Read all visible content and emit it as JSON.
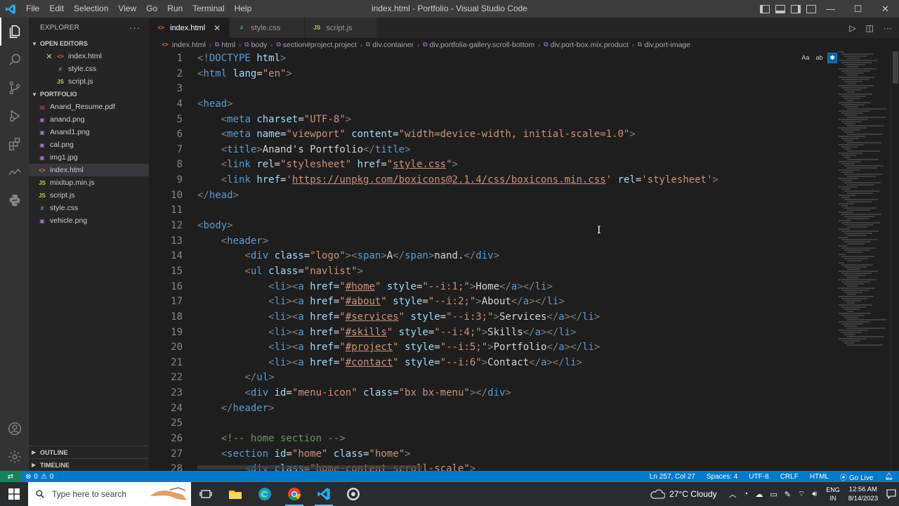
{
  "titlebar": {
    "menu": [
      "File",
      "Edit",
      "Selection",
      "View",
      "Go",
      "Run",
      "Terminal",
      "Help"
    ],
    "window_title": "index.html - Portfolio - Visual Studio Code"
  },
  "sidebar": {
    "header": "EXPLORER",
    "more": "···",
    "open_editors_title": "OPEN EDITORS",
    "open_editors": [
      {
        "name": "index.html",
        "type": "html",
        "badge": "<>"
      },
      {
        "name": "style.css",
        "type": "css",
        "badge": "#"
      },
      {
        "name": "script.js",
        "type": "js",
        "badge": "JS"
      }
    ],
    "folder_title": "PORTFOLIO",
    "files": [
      {
        "name": "Anand_Resume.pdf",
        "type": "pdf",
        "badge": "▤"
      },
      {
        "name": "anand.png",
        "type": "img",
        "badge": "▣"
      },
      {
        "name": "Anand1.png",
        "type": "img",
        "badge": "▣"
      },
      {
        "name": "cal.png",
        "type": "img",
        "badge": "▣"
      },
      {
        "name": "img1.jpg",
        "type": "img",
        "badge": "▣"
      },
      {
        "name": "index.html",
        "type": "html",
        "badge": "<>"
      },
      {
        "name": "mixitup.min.js",
        "type": "js",
        "badge": "JS"
      },
      {
        "name": "script.js",
        "type": "js",
        "badge": "JS"
      },
      {
        "name": "style.css",
        "type": "css",
        "badge": "#"
      },
      {
        "name": "vehicle.png",
        "type": "img",
        "badge": "▣"
      }
    ],
    "outline_title": "OUTLINE",
    "timeline_title": "TIMELINE"
  },
  "tabs": [
    {
      "label": "index.html",
      "type": "html",
      "badge": "<>",
      "active": true
    },
    {
      "label": "style.css",
      "type": "css",
      "badge": "#",
      "active": false
    },
    {
      "label": "script.js",
      "type": "js",
      "badge": "JS",
      "active": false
    }
  ],
  "breadcrumbs": [
    "index.html",
    "html",
    "body",
    "section#project.project",
    "div.container",
    "div.portfolia-gallery.scroll-bottom",
    "div.port-box.mix.product",
    "div.port-image"
  ],
  "find_toggles": [
    "Aa",
    "ab",
    "✱"
  ],
  "code": {
    "line_numbers": [
      "1",
      "2",
      "3",
      "4",
      "5",
      "6",
      "7",
      "8",
      "9",
      "10",
      "11",
      "12",
      "13",
      "14",
      "15",
      "16",
      "17",
      "18",
      "19",
      "20",
      "21",
      "22",
      "23",
      "24",
      "25",
      "26",
      "27",
      "28"
    ],
    "lines": [
      [
        [
          "br",
          "<!"
        ],
        [
          "tag",
          "DOCTYPE"
        ],
        [
          "tx",
          " "
        ],
        [
          "at",
          "html"
        ],
        [
          "br",
          ">"
        ]
      ],
      [
        [
          "br",
          "<"
        ],
        [
          "tag",
          "html"
        ],
        [
          "tx",
          " "
        ],
        [
          "at",
          "lang"
        ],
        [
          "tx",
          "="
        ],
        [
          "st",
          "\"en\""
        ],
        [
          "br",
          ">"
        ]
      ],
      [],
      [
        [
          "br",
          "<"
        ],
        [
          "tag",
          "head"
        ],
        [
          "br",
          ">"
        ]
      ],
      [
        [
          "tx",
          "    "
        ],
        [
          "br",
          "<"
        ],
        [
          "tag",
          "meta"
        ],
        [
          "tx",
          " "
        ],
        [
          "at",
          "charset"
        ],
        [
          "tx",
          "="
        ],
        [
          "st",
          "\"UTF-8\""
        ],
        [
          "br",
          ">"
        ]
      ],
      [
        [
          "tx",
          "    "
        ],
        [
          "br",
          "<"
        ],
        [
          "tag",
          "meta"
        ],
        [
          "tx",
          " "
        ],
        [
          "at",
          "name"
        ],
        [
          "tx",
          "="
        ],
        [
          "st",
          "\"viewport\""
        ],
        [
          "tx",
          " "
        ],
        [
          "at",
          "content"
        ],
        [
          "tx",
          "="
        ],
        [
          "st",
          "\"width=device-width, initial-scale=1.0\""
        ],
        [
          "br",
          ">"
        ]
      ],
      [
        [
          "tx",
          "    "
        ],
        [
          "br",
          "<"
        ],
        [
          "tag",
          "title"
        ],
        [
          "br",
          ">"
        ],
        [
          "tx",
          "Anand's Portfolio"
        ],
        [
          "br",
          "</"
        ],
        [
          "tag",
          "title"
        ],
        [
          "br",
          ">"
        ]
      ],
      [
        [
          "tx",
          "    "
        ],
        [
          "br",
          "<"
        ],
        [
          "tag",
          "link"
        ],
        [
          "tx",
          " "
        ],
        [
          "at",
          "rel"
        ],
        [
          "tx",
          "="
        ],
        [
          "st",
          "\"stylesheet\""
        ],
        [
          "tx",
          " "
        ],
        [
          "at",
          "href"
        ],
        [
          "tx",
          "="
        ],
        [
          "st",
          "\""
        ],
        [
          "ln",
          "style.css"
        ],
        [
          "st",
          "\""
        ],
        [
          "br",
          ">"
        ]
      ],
      [
        [
          "tx",
          "    "
        ],
        [
          "br",
          "<"
        ],
        [
          "tag",
          "link"
        ],
        [
          "tx",
          " "
        ],
        [
          "at",
          "href"
        ],
        [
          "tx",
          "="
        ],
        [
          "st",
          "'"
        ],
        [
          "ln",
          "https://unpkg.com/boxicons@2.1.4/css/boxicons.min.css"
        ],
        [
          "st",
          "'"
        ],
        [
          "tx",
          " "
        ],
        [
          "at",
          "rel"
        ],
        [
          "tx",
          "="
        ],
        [
          "st",
          "'stylesheet'"
        ],
        [
          "br",
          ">"
        ]
      ],
      [
        [
          "br",
          "</"
        ],
        [
          "tag",
          "head"
        ],
        [
          "br",
          ">"
        ]
      ],
      [],
      [
        [
          "br",
          "<"
        ],
        [
          "tag",
          "body"
        ],
        [
          "br",
          ">"
        ]
      ],
      [
        [
          "tx",
          "    "
        ],
        [
          "br",
          "<"
        ],
        [
          "tag",
          "header"
        ],
        [
          "br",
          ">"
        ]
      ],
      [
        [
          "tx",
          "        "
        ],
        [
          "br",
          "<"
        ],
        [
          "tag",
          "div"
        ],
        [
          "tx",
          " "
        ],
        [
          "at",
          "class"
        ],
        [
          "tx",
          "="
        ],
        [
          "st",
          "\"logo\""
        ],
        [
          "br",
          "><"
        ],
        [
          "tag",
          "span"
        ],
        [
          "br",
          ">"
        ],
        [
          "tx",
          "A"
        ],
        [
          "br",
          "</"
        ],
        [
          "tag",
          "span"
        ],
        [
          "br",
          ">"
        ],
        [
          "tx",
          "nand."
        ],
        [
          "br",
          "</"
        ],
        [
          "tag",
          "div"
        ],
        [
          "br",
          ">"
        ]
      ],
      [
        [
          "tx",
          "        "
        ],
        [
          "br",
          "<"
        ],
        [
          "tag",
          "ul"
        ],
        [
          "tx",
          " "
        ],
        [
          "at",
          "class"
        ],
        [
          "tx",
          "="
        ],
        [
          "st",
          "\"navlist\""
        ],
        [
          "br",
          ">"
        ]
      ],
      [
        [
          "tx",
          "            "
        ],
        [
          "br",
          "<"
        ],
        [
          "tag",
          "li"
        ],
        [
          "br",
          "><"
        ],
        [
          "tag",
          "a"
        ],
        [
          "tx",
          " "
        ],
        [
          "at",
          "href"
        ],
        [
          "tx",
          "="
        ],
        [
          "st",
          "\""
        ],
        [
          "ln",
          "#home"
        ],
        [
          "st",
          "\""
        ],
        [
          "tx",
          " "
        ],
        [
          "at",
          "style"
        ],
        [
          "tx",
          "="
        ],
        [
          "st",
          "\"--i:1;\""
        ],
        [
          "br",
          ">"
        ],
        [
          "tx",
          "Home"
        ],
        [
          "br",
          "</"
        ],
        [
          "tag",
          "a"
        ],
        [
          "br",
          "></"
        ],
        [
          "tag",
          "li"
        ],
        [
          "br",
          ">"
        ]
      ],
      [
        [
          "tx",
          "            "
        ],
        [
          "br",
          "<"
        ],
        [
          "tag",
          "li"
        ],
        [
          "br",
          "><"
        ],
        [
          "tag",
          "a"
        ],
        [
          "tx",
          " "
        ],
        [
          "at",
          "href"
        ],
        [
          "tx",
          "="
        ],
        [
          "st",
          "\""
        ],
        [
          "ln",
          "#about"
        ],
        [
          "st",
          "\""
        ],
        [
          "tx",
          " "
        ],
        [
          "at",
          "style"
        ],
        [
          "tx",
          "="
        ],
        [
          "st",
          "\"--i:2;\""
        ],
        [
          "br",
          ">"
        ],
        [
          "tx",
          "About"
        ],
        [
          "br",
          "</"
        ],
        [
          "tag",
          "a"
        ],
        [
          "br",
          "></"
        ],
        [
          "tag",
          "li"
        ],
        [
          "br",
          ">"
        ]
      ],
      [
        [
          "tx",
          "            "
        ],
        [
          "br",
          "<"
        ],
        [
          "tag",
          "li"
        ],
        [
          "br",
          "><"
        ],
        [
          "tag",
          "a"
        ],
        [
          "tx",
          " "
        ],
        [
          "at",
          "href"
        ],
        [
          "tx",
          "="
        ],
        [
          "st",
          "\""
        ],
        [
          "ln",
          "#services"
        ],
        [
          "st",
          "\""
        ],
        [
          "tx",
          " "
        ],
        [
          "at",
          "style"
        ],
        [
          "tx",
          "="
        ],
        [
          "st",
          "\"--i:3;\""
        ],
        [
          "br",
          ">"
        ],
        [
          "tx",
          "Services"
        ],
        [
          "br",
          "</"
        ],
        [
          "tag",
          "a"
        ],
        [
          "br",
          "></"
        ],
        [
          "tag",
          "li"
        ],
        [
          "br",
          ">"
        ]
      ],
      [
        [
          "tx",
          "            "
        ],
        [
          "br",
          "<"
        ],
        [
          "tag",
          "li"
        ],
        [
          "br",
          "><"
        ],
        [
          "tag",
          "a"
        ],
        [
          "tx",
          " "
        ],
        [
          "at",
          "href"
        ],
        [
          "tx",
          "="
        ],
        [
          "st",
          "\""
        ],
        [
          "ln",
          "#skills"
        ],
        [
          "st",
          "\""
        ],
        [
          "tx",
          " "
        ],
        [
          "at",
          "style"
        ],
        [
          "tx",
          "="
        ],
        [
          "st",
          "\"--i:4;\""
        ],
        [
          "br",
          ">"
        ],
        [
          "tx",
          "Skills"
        ],
        [
          "br",
          "</"
        ],
        [
          "tag",
          "a"
        ],
        [
          "br",
          "></"
        ],
        [
          "tag",
          "li"
        ],
        [
          "br",
          ">"
        ]
      ],
      [
        [
          "tx",
          "            "
        ],
        [
          "br",
          "<"
        ],
        [
          "tag",
          "li"
        ],
        [
          "br",
          "><"
        ],
        [
          "tag",
          "a"
        ],
        [
          "tx",
          " "
        ],
        [
          "at",
          "href"
        ],
        [
          "tx",
          "="
        ],
        [
          "st",
          "\""
        ],
        [
          "ln",
          "#project"
        ],
        [
          "st",
          "\""
        ],
        [
          "tx",
          " "
        ],
        [
          "at",
          "style"
        ],
        [
          "tx",
          "="
        ],
        [
          "st",
          "\"--i:5;\""
        ],
        [
          "br",
          ">"
        ],
        [
          "tx",
          "Portfolio"
        ],
        [
          "br",
          "</"
        ],
        [
          "tag",
          "a"
        ],
        [
          "br",
          "></"
        ],
        [
          "tag",
          "li"
        ],
        [
          "br",
          ">"
        ]
      ],
      [
        [
          "tx",
          "            "
        ],
        [
          "br",
          "<"
        ],
        [
          "tag",
          "li"
        ],
        [
          "br",
          "><"
        ],
        [
          "tag",
          "a"
        ],
        [
          "tx",
          " "
        ],
        [
          "at",
          "href"
        ],
        [
          "tx",
          "="
        ],
        [
          "st",
          "\""
        ],
        [
          "ln",
          "#contact"
        ],
        [
          "st",
          "\""
        ],
        [
          "tx",
          " "
        ],
        [
          "at",
          "style"
        ],
        [
          "tx",
          "="
        ],
        [
          "st",
          "\"--i:6\""
        ],
        [
          "br",
          ">"
        ],
        [
          "tx",
          "Contact"
        ],
        [
          "br",
          "</"
        ],
        [
          "tag",
          "a"
        ],
        [
          "br",
          "></"
        ],
        [
          "tag",
          "li"
        ],
        [
          "br",
          ">"
        ]
      ],
      [
        [
          "tx",
          "        "
        ],
        [
          "br",
          "</"
        ],
        [
          "tag",
          "ul"
        ],
        [
          "br",
          ">"
        ]
      ],
      [
        [
          "tx",
          "        "
        ],
        [
          "br",
          "<"
        ],
        [
          "tag",
          "div"
        ],
        [
          "tx",
          " "
        ],
        [
          "at",
          "id"
        ],
        [
          "tx",
          "="
        ],
        [
          "st",
          "\"menu-icon\""
        ],
        [
          "tx",
          " "
        ],
        [
          "at",
          "class"
        ],
        [
          "tx",
          "="
        ],
        [
          "st",
          "\"bx bx-menu\""
        ],
        [
          "br",
          "></"
        ],
        [
          "tag",
          "div"
        ],
        [
          "br",
          ">"
        ]
      ],
      [
        [
          "tx",
          "    "
        ],
        [
          "br",
          "</"
        ],
        [
          "tag",
          "header"
        ],
        [
          "br",
          ">"
        ]
      ],
      [],
      [
        [
          "tx",
          "    "
        ],
        [
          "cm",
          "<!-- home section -->"
        ]
      ],
      [
        [
          "tx",
          "    "
        ],
        [
          "br",
          "<"
        ],
        [
          "tag",
          "section"
        ],
        [
          "tx",
          " "
        ],
        [
          "at",
          "id"
        ],
        [
          "tx",
          "="
        ],
        [
          "st",
          "\"home\""
        ],
        [
          "tx",
          " "
        ],
        [
          "at",
          "class"
        ],
        [
          "tx",
          "="
        ],
        [
          "st",
          "\"home\""
        ],
        [
          "br",
          ">"
        ]
      ],
      [
        [
          "tx",
          "        "
        ],
        [
          "br",
          "<"
        ],
        [
          "tag",
          "div"
        ],
        [
          "tx",
          " "
        ],
        [
          "at",
          "class"
        ],
        [
          "tx",
          "="
        ],
        [
          "st",
          "\"home-content scroll-scale\""
        ],
        [
          "br",
          ">"
        ]
      ]
    ]
  },
  "statusbar": {
    "errors": "0",
    "warnings": "0",
    "position": "Ln 257, Col 27",
    "spaces": "Spaces: 4",
    "encoding": "UTF-8",
    "eol": "CRLF",
    "language": "HTML",
    "golive": "Go Live"
  },
  "taskbar": {
    "search_placeholder": "Type here to search",
    "weather": "27°C  Cloudy",
    "lang_top": "ENG",
    "lang_bottom": "IN",
    "time": "12:56 AM",
    "date": "8/14/2023"
  }
}
